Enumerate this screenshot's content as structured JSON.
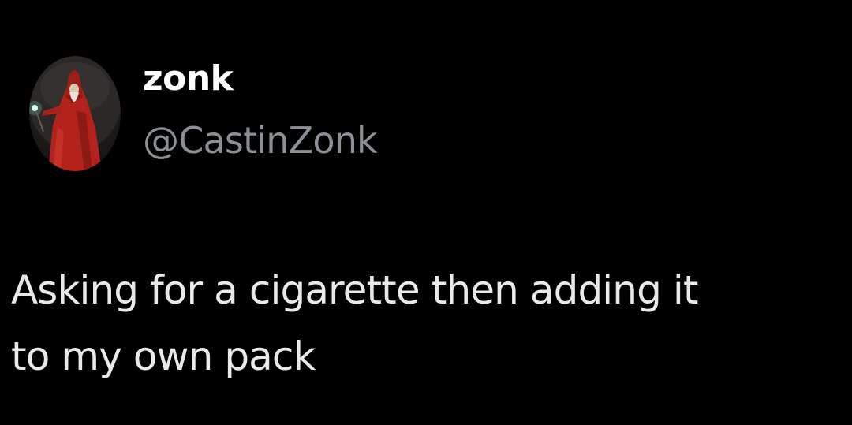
{
  "tweet": {
    "author": {
      "display_name": "zonk",
      "handle": "@CastinZonk",
      "avatar_icon": "wizard-avatar-icon"
    },
    "text": "Asking for a cigarette then adding it\nto my own pack"
  },
  "colors": {
    "background": "#000000",
    "display_name": "#ffffff",
    "handle": "#8b9096",
    "body_text": "#e7e9ea"
  }
}
